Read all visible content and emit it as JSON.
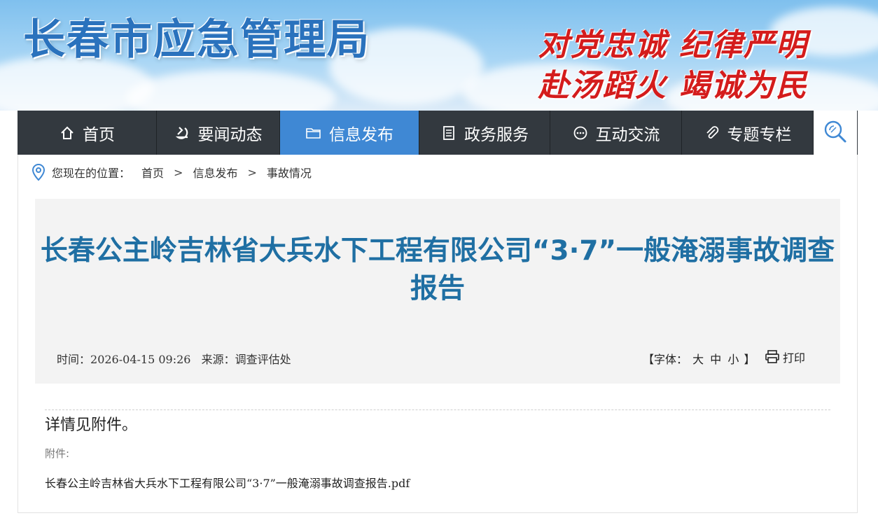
{
  "header": {
    "site_title": "长春市应急管理局",
    "slogan_line1": "对党忠诚  纪律严明",
    "slogan_line2": "赴汤蹈火  竭诚为民"
  },
  "nav": {
    "items": [
      {
        "label": "首页",
        "icon": "home-icon"
      },
      {
        "label": "要闻动态",
        "icon": "hammer-sickle-icon"
      },
      {
        "label": "信息发布",
        "icon": "folder-icon",
        "active": true
      },
      {
        "label": "政务服务",
        "icon": "document-icon"
      },
      {
        "label": "互动交流",
        "icon": "chat-bubble-icon"
      },
      {
        "label": "专题专栏",
        "icon": "paperclip-icon"
      }
    ],
    "search_icon": "search-icon"
  },
  "breadcrumb": {
    "prefix": "您现在的位置：",
    "items": [
      "首页",
      "信息发布",
      "事故情况"
    ],
    "separator": ">"
  },
  "article": {
    "title": "长春公主岭吉林省大兵水下工程有限公司“3·7”一般淹溺事故调查报告",
    "time_label": "时间：",
    "time": "2026-04-15 09:26",
    "source_label": "来源：",
    "source": "调查评估处",
    "font_label": "【字体：",
    "font_sizes": [
      "大",
      "中",
      "小"
    ],
    "font_close": "】",
    "print_label": "打印",
    "body": "详情见附件。",
    "attachment_label": "附件:",
    "attachment_name": "长春公主岭吉林省大兵水下工程有限公司“3·7”一般淹溺事故调查报告.pdf"
  },
  "colors": {
    "nav_bg": "#33393f",
    "nav_active": "#3f88d4",
    "title_blue": "#1f6fa3",
    "slogan_red": "#d41c1c",
    "site_title_blue": "#2a72bd"
  }
}
